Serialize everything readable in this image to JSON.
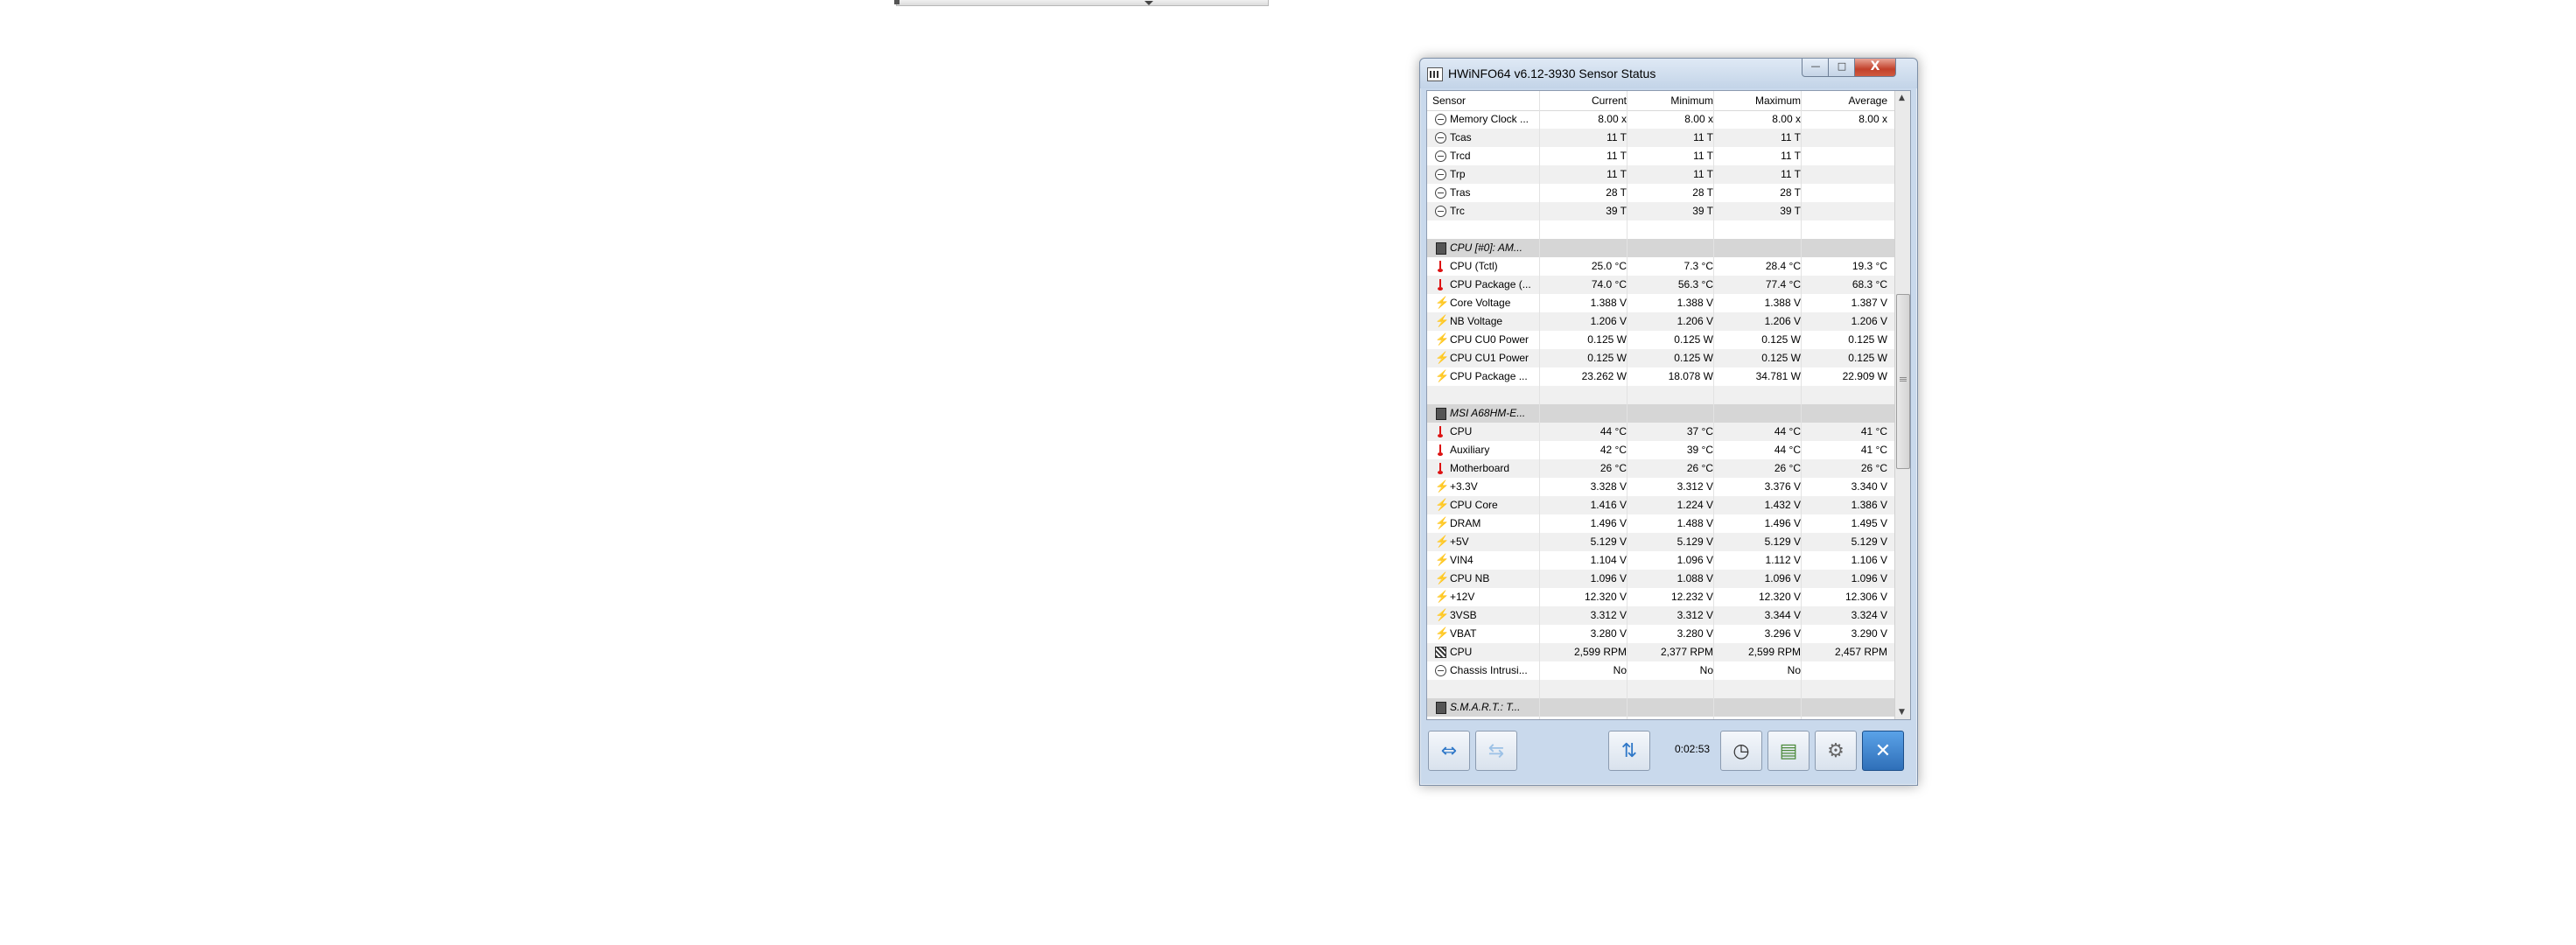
{
  "window": {
    "title": "HWiNFO64 v6.12-3930 Sensor Status",
    "caption_min": "—",
    "caption_max": "□",
    "caption_close": "X"
  },
  "columns": {
    "sensor": "Sensor",
    "current": "Current",
    "minimum": "Minimum",
    "maximum": "Maximum",
    "average": "Average"
  },
  "rows": [
    {
      "type": "item",
      "icon": "minus-circle-icon",
      "name": "Memory Clock ...",
      "cur": "8.00 x",
      "min": "8.00 x",
      "max": "8.00 x",
      "avg": "8.00 x"
    },
    {
      "type": "item",
      "icon": "minus-circle-icon",
      "name": "Tcas",
      "cur": "11 T",
      "min": "11 T",
      "max": "11 T",
      "avg": ""
    },
    {
      "type": "item",
      "icon": "minus-circle-icon",
      "name": "Trcd",
      "cur": "11 T",
      "min": "11 T",
      "max": "11 T",
      "avg": ""
    },
    {
      "type": "item",
      "icon": "minus-circle-icon",
      "name": "Trp",
      "cur": "11 T",
      "min": "11 T",
      "max": "11 T",
      "avg": ""
    },
    {
      "type": "item",
      "icon": "minus-circle-icon",
      "name": "Tras",
      "cur": "28 T",
      "min": "28 T",
      "max": "28 T",
      "avg": ""
    },
    {
      "type": "item",
      "icon": "minus-circle-icon",
      "name": "Trc",
      "cur": "39 T",
      "min": "39 T",
      "max": "39 T",
      "avg": ""
    },
    {
      "type": "blank"
    },
    {
      "type": "group",
      "icon": "chip-icon",
      "name": "CPU [#0]: AM..."
    },
    {
      "type": "item",
      "icon": "thermometer-icon",
      "name": "CPU (Tctl)",
      "cur": "25.0 °C",
      "min": "7.3 °C",
      "max": "28.4 °C",
      "avg": "19.3 °C"
    },
    {
      "type": "item",
      "icon": "thermometer-icon",
      "name": "CPU Package (...",
      "cur": "74.0 °C",
      "min": "56.3 °C",
      "max": "77.4 °C",
      "avg": "68.3 °C"
    },
    {
      "type": "item",
      "icon": "voltage-bolt-icon",
      "name": "Core Voltage",
      "cur": "1.388 V",
      "min": "1.388 V",
      "max": "1.388 V",
      "avg": "1.387 V"
    },
    {
      "type": "item",
      "icon": "voltage-bolt-icon",
      "name": "NB Voltage",
      "cur": "1.206 V",
      "min": "1.206 V",
      "max": "1.206 V",
      "avg": "1.206 V"
    },
    {
      "type": "item",
      "icon": "voltage-bolt-icon",
      "name": "CPU CU0 Power",
      "cur": "0.125 W",
      "min": "0.125 W",
      "max": "0.125 W",
      "avg": "0.125 W"
    },
    {
      "type": "item",
      "icon": "voltage-bolt-icon",
      "name": "CPU CU1 Power",
      "cur": "0.125 W",
      "min": "0.125 W",
      "max": "0.125 W",
      "avg": "0.125 W"
    },
    {
      "type": "item",
      "icon": "voltage-bolt-icon",
      "name": "CPU Package ...",
      "cur": "23.262 W",
      "min": "18.078 W",
      "max": "34.781 W",
      "avg": "22.909 W"
    },
    {
      "type": "blank"
    },
    {
      "type": "group",
      "icon": "chip-icon",
      "name": "MSI A68HM-E..."
    },
    {
      "type": "item",
      "icon": "thermometer-icon",
      "name": "CPU",
      "cur": "44 °C",
      "min": "37 °C",
      "max": "44 °C",
      "avg": "41 °C"
    },
    {
      "type": "item",
      "icon": "thermometer-icon",
      "name": "Auxiliary",
      "cur": "42 °C",
      "min": "39 °C",
      "max": "44 °C",
      "avg": "41 °C"
    },
    {
      "type": "item",
      "icon": "thermometer-icon",
      "name": "Motherboard",
      "cur": "26 °C",
      "min": "26 °C",
      "max": "26 °C",
      "avg": "26 °C"
    },
    {
      "type": "item",
      "icon": "voltage-bolt-icon",
      "name": "+3.3V",
      "cur": "3.328 V",
      "min": "3.312 V",
      "max": "3.376 V",
      "avg": "3.340 V"
    },
    {
      "type": "item",
      "icon": "voltage-bolt-icon",
      "name": "CPU Core",
      "cur": "1.416 V",
      "min": "1.224 V",
      "max": "1.432 V",
      "avg": "1.386 V"
    },
    {
      "type": "item",
      "icon": "voltage-bolt-icon",
      "name": "DRAM",
      "cur": "1.496 V",
      "min": "1.488 V",
      "max": "1.496 V",
      "avg": "1.495 V"
    },
    {
      "type": "item",
      "icon": "voltage-bolt-icon",
      "name": "+5V",
      "cur": "5.129 V",
      "min": "5.129 V",
      "max": "5.129 V",
      "avg": "5.129 V"
    },
    {
      "type": "item",
      "icon": "voltage-bolt-icon",
      "name": "VIN4",
      "cur": "1.104 V",
      "min": "1.096 V",
      "max": "1.112 V",
      "avg": "1.106 V"
    },
    {
      "type": "item",
      "icon": "voltage-bolt-icon",
      "name": "CPU NB",
      "cur": "1.096 V",
      "min": "1.088 V",
      "max": "1.096 V",
      "avg": "1.096 V"
    },
    {
      "type": "item",
      "icon": "voltage-bolt-icon",
      "name": "+12V",
      "cur": "12.320 V",
      "min": "12.232 V",
      "max": "12.320 V",
      "avg": "12.306 V"
    },
    {
      "type": "item",
      "icon": "voltage-bolt-icon",
      "name": "3VSB",
      "cur": "3.312 V",
      "min": "3.312 V",
      "max": "3.344 V",
      "avg": "3.324 V"
    },
    {
      "type": "item",
      "icon": "voltage-bolt-icon",
      "name": "VBAT",
      "cur": "3.280 V",
      "min": "3.280 V",
      "max": "3.296 V",
      "avg": "3.290 V"
    },
    {
      "type": "item",
      "icon": "fan-icon",
      "name": "CPU",
      "cur": "2,599 RPM",
      "min": "2,377 RPM",
      "max": "2,599 RPM",
      "avg": "2,457 RPM"
    },
    {
      "type": "item",
      "icon": "minus-circle-icon",
      "name": "Chassis Intrusi...",
      "cur": "No",
      "min": "No",
      "max": "No",
      "avg": ""
    },
    {
      "type": "blank"
    },
    {
      "type": "group",
      "icon": "chip-icon",
      "name": "S.M.A.R.T.: T..."
    }
  ],
  "toolbar": {
    "elapsed": "0:02:53",
    "nav_forward_icon": "double-arrow-icon",
    "nav_collapse_icon": "collapse-arrows-icon",
    "network_icon": "network-icon",
    "clock_icon": "clock-icon",
    "report_icon": "report-icon",
    "settings_icon": "gear-icon",
    "close_icon": "close-icon",
    "glyph_nav": "⇔",
    "glyph_collapse": "⇆",
    "glyph_network": "⇅",
    "glyph_clock": "◷",
    "glyph_report": "▤",
    "glyph_settings": "⚙",
    "glyph_close": "✕"
  },
  "scrollbar": {
    "up_arrow": "▲",
    "down_arrow": "▼",
    "position_fraction": 0.32
  }
}
